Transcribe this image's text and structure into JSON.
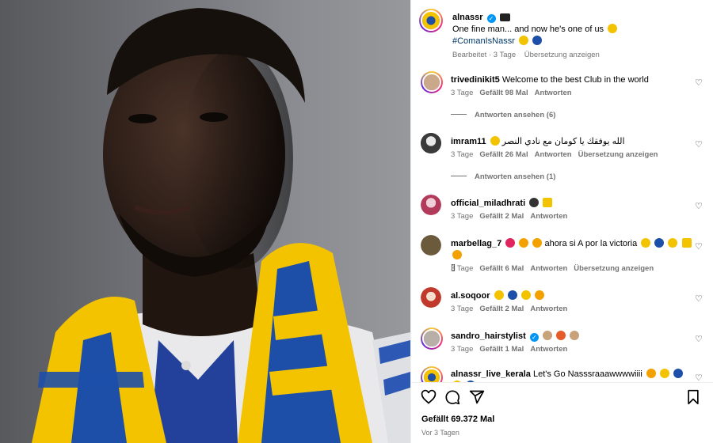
{
  "post": {
    "author": "alnassr",
    "caption_text": "One fine man... and now he's one of us",
    "hashtag": "#ComanIsNassr",
    "edited": "Bearbeitet · 3 Tage",
    "translate": "Übersetzung anzeigen"
  },
  "comments": [
    {
      "user": "trivedinikit5",
      "text": "Welcome to the best Club in the world",
      "age": "3 Tage",
      "likes": "Gefällt 98 Mal",
      "reply": "Antworten",
      "translate": "",
      "view_replies": "Antworten ansehen (6)",
      "avatar_color": "#c9a98a"
    },
    {
      "user": "imram11",
      "text": "الله يوفقك يا كومان مع نادي النصر",
      "age": "3 Tage",
      "likes": "Gefällt 26 Mal",
      "reply": "Antworten",
      "translate": "Übersetzung anzeigen",
      "view_replies": "Antworten ansehen (1)",
      "avatar_color": "#3a3a3a"
    },
    {
      "user": "official_miladhrati",
      "text": "",
      "age": "3 Tage",
      "likes": "Gefällt 2 Mal",
      "reply": "Antworten",
      "translate": "",
      "view_replies": "",
      "avatar_color": "#b23a5a"
    },
    {
      "user": "marbellag_7",
      "text": "ahora si A por la victoria",
      "text2": "▯",
      "age": "3 Tage",
      "likes": "Gefällt 6 Mal",
      "reply": "Antworten",
      "translate": "Übersetzung anzeigen",
      "view_replies": "",
      "avatar_color": "#6b5a3c"
    },
    {
      "user": "al.soqoor",
      "text": "",
      "age": "3 Tage",
      "likes": "Gefällt 2 Mal",
      "reply": "Antworten",
      "translate": "",
      "view_replies": "",
      "avatar_color": "#c0392b"
    },
    {
      "user": "sandro_hairstylist",
      "text": "",
      "age": "3 Tage",
      "likes": "Gefällt 1 Mal",
      "reply": "Antworten",
      "translate": "",
      "view_replies": "",
      "avatar_color": "#b8b0a8"
    },
    {
      "user": "alnassr_live_kerala",
      "text": "Let's Go Nasssraaawwwwiiii",
      "age": "",
      "likes": "",
      "reply": "",
      "translate": "",
      "view_replies": "",
      "avatar_color": "#f3c300"
    }
  ],
  "footer": {
    "likes": "Gefällt 69.372 Mal",
    "time": "Vor 3 Tagen"
  },
  "colors": {
    "club_yellow": "#f3c300",
    "club_blue": "#1d4fa8",
    "link": "#00376b",
    "muted": "#737373"
  },
  "icons": [
    "verified-icon",
    "heart-icon",
    "comment-icon",
    "share-icon",
    "bookmark-icon"
  ]
}
